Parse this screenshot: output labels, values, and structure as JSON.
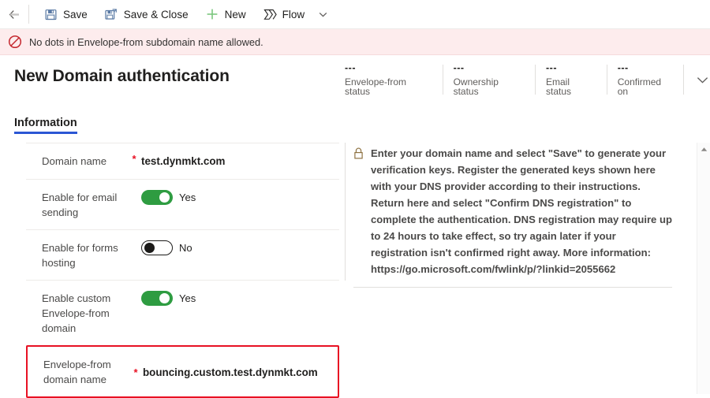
{
  "commandbar": {
    "back_tooltip": "Back",
    "items": [
      {
        "label": "Save",
        "icon": "save-icon"
      },
      {
        "label": "Save & Close",
        "icon": "save-and-close-icon"
      },
      {
        "label": "New",
        "icon": "plus-icon"
      },
      {
        "label": "Flow",
        "icon": "flow-icon"
      }
    ],
    "overflow_icon": "chevron-down-icon"
  },
  "error_banner": {
    "icon": "blocked-icon",
    "message": "No dots in Envelope-from subdomain name allowed."
  },
  "header": {
    "title": "New Domain authentication",
    "expand_icon": "chevron-down-icon",
    "status_fields": [
      {
        "value": "---",
        "label": "Envelope-from status"
      },
      {
        "value": "---",
        "label": "Ownership status"
      },
      {
        "value": "---",
        "label": "Email status"
      },
      {
        "value": "---",
        "label": "Confirmed on"
      }
    ]
  },
  "tabs": [
    {
      "label": "Information",
      "active": true
    }
  ],
  "form": {
    "rows": [
      {
        "label": "Domain name",
        "required": "*",
        "type": "text",
        "value": "test.dynmkt.com"
      },
      {
        "label": "Enable for email sending",
        "required": "",
        "type": "toggle",
        "state": "on",
        "value": "Yes"
      },
      {
        "label": "Enable for forms hosting",
        "required": "",
        "type": "toggle",
        "state": "off",
        "value": "No"
      },
      {
        "label": "Enable custom Envelope-from domain",
        "required": "",
        "type": "toggle",
        "state": "on",
        "value": "Yes"
      },
      {
        "label": "Envelope-from domain name",
        "required": "*",
        "type": "text",
        "value": "bouncing.custom.test.dynmkt.com",
        "error": true
      }
    ]
  },
  "help": {
    "icon": "lock-icon",
    "text": "Enter your domain name and select \"Save\" to generate your verification keys. Register the generated keys shown here with your DNS provider according to their instructions. Return here and select \"Confirm DNS registration\" to complete the authentication. DNS registration may require up to 24 hours to take effect, so try again later if your registration isn't confirmed right away. More information: https://go.microsoft.com/fwlink/p/?linkid=2055662"
  },
  "scrollbar": {
    "up_icon": "caret-up-icon"
  },
  "colors": {
    "accent": "#2b56d4",
    "toggle_on": "#2e9c41",
    "error": "#e81123",
    "error_bg": "#fdeced",
    "plus_green": "#7bc67e"
  }
}
